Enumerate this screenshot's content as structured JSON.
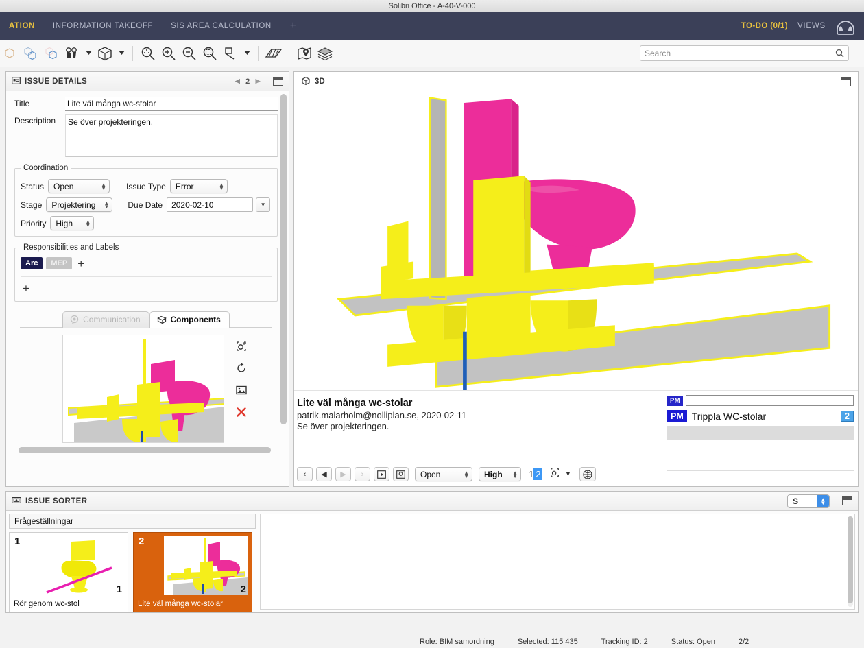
{
  "window": {
    "title": "Solibri Office - A-40-V-000"
  },
  "navbar": {
    "tabs": [
      {
        "label": "ATION",
        "active": true
      },
      {
        "label": "INFORMATION TAKEOFF",
        "active": false
      },
      {
        "label": "SIS AREA CALCULATION",
        "active": false
      },
      {
        "label": "+",
        "active": false
      }
    ],
    "todo": "TO-DO (0/1)",
    "views": "VIEWS"
  },
  "toolbar": {
    "search_placeholder": "Search",
    "search_value": ""
  },
  "issue_details": {
    "panel_title": "ISSUE DETAILS",
    "nav_index": "2",
    "title_label": "Title",
    "title_value": "Lite väl många wc-stolar",
    "description_label": "Description",
    "description_value": "Se över projekteringen.",
    "coordination": {
      "legend": "Coordination",
      "status_label": "Status",
      "status_value": "Open",
      "issue_type_label": "Issue Type",
      "issue_type_value": "Error",
      "stage_label": "Stage",
      "stage_value": "Projektering",
      "due_date_label": "Due Date",
      "due_date_value": "2020-02-10",
      "priority_label": "Priority",
      "priority_value": "High"
    },
    "responsibilities": {
      "legend": "Responsibilities and Labels",
      "tags": [
        {
          "label": "Arc",
          "bg": "#1a1a4e",
          "fg": "#ffffff"
        },
        {
          "label": "MEP",
          "bg": "#c4c4c4",
          "fg": "#f0f0f0"
        }
      ],
      "add_label": "+",
      "add_label_2": "+"
    },
    "tabs": [
      {
        "label": "Communication",
        "active": false
      },
      {
        "label": "Components",
        "active": true
      }
    ]
  },
  "view3d": {
    "header_label": "3D"
  },
  "comment": {
    "title": "Lite väl många wc-stolar",
    "meta": "patrik.malarholm@nolliplan.se, 2020-02-11",
    "text": "Se över projekteringen.",
    "toolbar": {
      "first_label": "‹",
      "prev_label": "◀",
      "next_label": "▶",
      "last_label": "›",
      "play_label": "▶",
      "snap_label": "⧉",
      "status_value": "Open",
      "priority_value": "High",
      "page_left": "1",
      "page_sel": "2",
      "caret_label": "▼"
    }
  },
  "pm_panel": {
    "input_badge": "PM",
    "input_value": "",
    "rows": [
      {
        "badge": "PM",
        "label": "Trippla WC-stolar",
        "count": "2"
      }
    ]
  },
  "sorter": {
    "panel_title": "ISSUE SORTER",
    "group_label": "Frågeställningar",
    "selector_value": "S",
    "cards": [
      {
        "index": "1",
        "number": "1",
        "caption": "Rör genom wc-stol",
        "selected": false
      },
      {
        "index": "2",
        "number": "2",
        "caption": "Lite väl många wc-stolar",
        "selected": true
      }
    ]
  },
  "statusbar": {
    "role": "Role: BIM samordning",
    "selected": "Selected: 115 435",
    "tracking": "Tracking ID: 2",
    "status": "Status: Open",
    "count": "2/2"
  },
  "colors": {
    "nav_bg": "#3b4058",
    "accent_gold": "#e8c13f",
    "selection_orange": "#d9620d",
    "pm_blue": "#1b1bd4",
    "count_blue": "#4ba3e8",
    "model_pink": "#ec2d9a",
    "model_yellow": "#f5ee1a",
    "model_gray": "#b8b8b8"
  }
}
